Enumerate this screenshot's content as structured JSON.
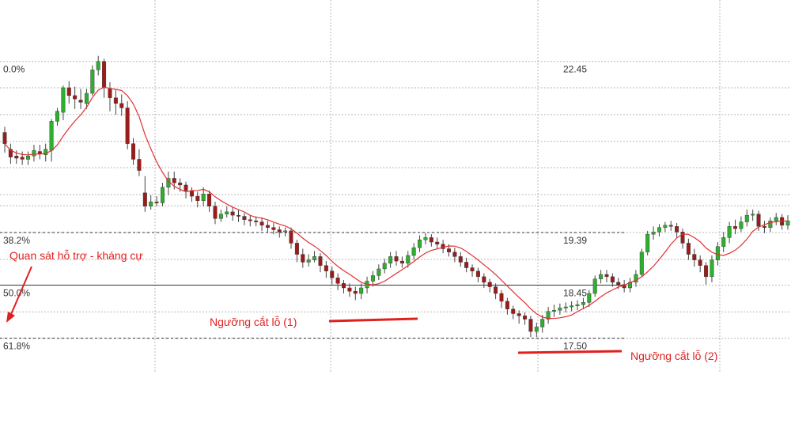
{
  "chart_data": {
    "type": "candlestick",
    "ylim": [
      16.9,
      23.55
    ],
    "grid": true,
    "colors": {
      "up": "#2fae2f",
      "down": "#9c1c1c",
      "ma_line": "#e03030",
      "grid": "#b8b8b8",
      "fib_line": "#333333",
      "annotation": "#e02020",
      "text": "#333333"
    },
    "fib_levels": [
      {
        "label": "0.0%",
        "price": 22.45,
        "price_label": "22.45"
      },
      {
        "label": "38.2%",
        "price": 19.39,
        "price_label": "19.39"
      },
      {
        "label": "50.0%",
        "price": 18.45,
        "price_label": "18.45"
      },
      {
        "label": "61.8%",
        "price": 17.5,
        "price_label": "17.50"
      }
    ],
    "annotations": [
      {
        "text": "Quan sát hỗ trợ - kháng cự"
      },
      {
        "text": "Ngưỡng cắt lỗ (1)"
      },
      {
        "text": "Ngưỡng cắt lỗ (2)"
      }
    ],
    "candles": [
      [
        21.18,
        20.98,
        21.28,
        20.82
      ],
      [
        20.88,
        20.74,
        20.98,
        20.62
      ],
      [
        20.76,
        20.72,
        20.86,
        20.62
      ],
      [
        20.74,
        20.7,
        20.84,
        20.6
      ],
      [
        20.7,
        20.76,
        20.84,
        20.6
      ],
      [
        20.76,
        20.86,
        20.96,
        20.66
      ],
      [
        20.84,
        20.8,
        20.96,
        20.7
      ],
      [
        20.78,
        20.88,
        20.98,
        20.66
      ],
      [
        20.86,
        21.38,
        21.42,
        20.66
      ],
      [
        21.38,
        21.56,
        21.62,
        21.3
      ],
      [
        21.54,
        21.98,
        22.02,
        21.4
      ],
      [
        21.98,
        21.84,
        22.1,
        21.7
      ],
      [
        21.84,
        21.78,
        22.0,
        21.6
      ],
      [
        21.76,
        21.72,
        21.96,
        21.6
      ],
      [
        21.7,
        21.88,
        21.96,
        21.6
      ],
      [
        21.88,
        22.3,
        22.38,
        21.84
      ],
      [
        22.3,
        22.45,
        22.55,
        22.2
      ],
      [
        22.45,
        21.98,
        22.5,
        21.8
      ],
      [
        21.96,
        21.8,
        22.08,
        21.56
      ],
      [
        21.8,
        21.7,
        21.94,
        21.5
      ],
      [
        21.7,
        21.62,
        21.86,
        21.48
      ],
      [
        21.62,
        20.98,
        21.74,
        20.88
      ],
      [
        20.98,
        20.7,
        21.08,
        20.6
      ],
      [
        20.7,
        20.5,
        20.88,
        20.4
      ],
      [
        20.1,
        19.86,
        20.4,
        19.76
      ],
      [
        19.86,
        19.94,
        20.06,
        19.8
      ],
      [
        19.94,
        19.92,
        20.04,
        19.86
      ],
      [
        19.92,
        20.2,
        20.28,
        19.86
      ],
      [
        20.2,
        20.36,
        20.48,
        20.06
      ],
      [
        20.36,
        20.28,
        20.48,
        20.16
      ],
      [
        20.28,
        20.24,
        20.36,
        20.12
      ],
      [
        20.24,
        20.14,
        20.3,
        20.0
      ],
      [
        20.14,
        20.04,
        20.2,
        19.94
      ],
      [
        20.04,
        19.96,
        20.12,
        19.84
      ],
      [
        19.96,
        20.08,
        20.2,
        19.86
      ],
      [
        20.08,
        19.86,
        20.14,
        19.76
      ],
      [
        19.86,
        19.64,
        19.94,
        19.54
      ],
      [
        19.64,
        19.72,
        19.8,
        19.58
      ],
      [
        19.72,
        19.76,
        19.86,
        19.66
      ],
      [
        19.76,
        19.7,
        19.84,
        19.6
      ],
      [
        19.7,
        19.68,
        19.8,
        19.58
      ],
      [
        19.68,
        19.62,
        19.74,
        19.52
      ],
      [
        19.62,
        19.6,
        19.7,
        19.5
      ],
      [
        19.6,
        19.58,
        19.68,
        19.5
      ],
      [
        19.58,
        19.52,
        19.66,
        19.42
      ],
      [
        19.52,
        19.48,
        19.6,
        19.38
      ],
      [
        19.48,
        19.44,
        19.56,
        19.36
      ],
      [
        19.44,
        19.4,
        19.5,
        19.3
      ],
      [
        19.4,
        19.42,
        19.48,
        19.32
      ],
      [
        19.42,
        19.2,
        19.48,
        19.1
      ],
      [
        19.2,
        19.0,
        19.26,
        18.86
      ],
      [
        19.0,
        18.86,
        19.1,
        18.76
      ],
      [
        18.86,
        18.9,
        19.0,
        18.78
      ],
      [
        18.9,
        18.96,
        19.06,
        18.86
      ],
      [
        18.96,
        18.8,
        19.02,
        18.68
      ],
      [
        18.8,
        18.7,
        18.88,
        18.58
      ],
      [
        18.7,
        18.58,
        18.78,
        18.46
      ],
      [
        18.58,
        18.48,
        18.66,
        18.36
      ],
      [
        18.48,
        18.4,
        18.54,
        18.3
      ],
      [
        18.4,
        18.34,
        18.48,
        18.24
      ],
      [
        18.34,
        18.3,
        18.42,
        18.18
      ],
      [
        18.3,
        18.4,
        18.48,
        18.2
      ],
      [
        18.4,
        18.52,
        18.6,
        18.3
      ],
      [
        18.52,
        18.62,
        18.7,
        18.42
      ],
      [
        18.62,
        18.74,
        18.82,
        18.54
      ],
      [
        18.74,
        18.84,
        18.92,
        18.66
      ],
      [
        18.84,
        18.96,
        19.04,
        18.76
      ],
      [
        18.96,
        18.88,
        19.06,
        18.8
      ],
      [
        18.88,
        18.84,
        18.96,
        18.76
      ],
      [
        18.84,
        18.98,
        19.06,
        18.76
      ],
      [
        18.98,
        19.12,
        19.2,
        18.9
      ],
      [
        19.12,
        19.26,
        19.34,
        19.04
      ],
      [
        19.26,
        19.3,
        19.38,
        19.18
      ],
      [
        19.3,
        19.22,
        19.36,
        19.14
      ],
      [
        19.22,
        19.18,
        19.3,
        19.1
      ],
      [
        19.18,
        19.1,
        19.26,
        19.02
      ],
      [
        19.1,
        19.04,
        19.18,
        18.96
      ],
      [
        19.04,
        18.96,
        19.12,
        18.86
      ],
      [
        18.96,
        18.86,
        19.04,
        18.78
      ],
      [
        18.86,
        18.76,
        18.94,
        18.68
      ],
      [
        18.76,
        18.7,
        18.82,
        18.6
      ],
      [
        18.7,
        18.6,
        18.76,
        18.5
      ],
      [
        18.6,
        18.5,
        18.66,
        18.4
      ],
      [
        18.5,
        18.42,
        18.56,
        18.32
      ],
      [
        18.42,
        18.3,
        18.48,
        18.2
      ],
      [
        18.3,
        18.16,
        18.36,
        18.04
      ],
      [
        18.16,
        18.02,
        18.22,
        17.92
      ],
      [
        18.02,
        17.94,
        18.08,
        17.84
      ],
      [
        17.94,
        17.9,
        18.0,
        17.76
      ],
      [
        17.9,
        17.84,
        17.96,
        17.74
      ],
      [
        17.84,
        17.62,
        17.9,
        17.52
      ],
      [
        17.62,
        17.7,
        17.78,
        17.52
      ],
      [
        17.7,
        17.84,
        17.92,
        17.6
      ],
      [
        17.84,
        17.98,
        18.06,
        17.76
      ],
      [
        17.98,
        18.0,
        18.1,
        17.88
      ],
      [
        18.0,
        18.04,
        18.12,
        17.92
      ],
      [
        18.04,
        18.06,
        18.14,
        17.96
      ],
      [
        18.06,
        18.08,
        18.16,
        17.98
      ],
      [
        18.08,
        18.1,
        18.18,
        18.0
      ],
      [
        18.1,
        18.14,
        18.22,
        18.02
      ],
      [
        18.14,
        18.3,
        18.36,
        18.06
      ],
      [
        18.3,
        18.56,
        18.62,
        18.24
      ],
      [
        18.56,
        18.64,
        18.72,
        18.48
      ],
      [
        18.64,
        18.6,
        18.72,
        18.5
      ],
      [
        18.6,
        18.5,
        18.66,
        18.42
      ],
      [
        18.5,
        18.46,
        18.58,
        18.38
      ],
      [
        18.46,
        18.4,
        18.54,
        18.32
      ],
      [
        18.4,
        18.5,
        18.58,
        18.32
      ],
      [
        18.5,
        18.64,
        18.72,
        18.42
      ],
      [
        18.64,
        19.04,
        19.1,
        18.6
      ],
      [
        19.04,
        19.36,
        19.42,
        18.98
      ],
      [
        19.36,
        19.4,
        19.5,
        19.26
      ],
      [
        19.4,
        19.48,
        19.54,
        19.32
      ],
      [
        19.48,
        19.52,
        19.58,
        19.4
      ],
      [
        19.52,
        19.5,
        19.6,
        19.42
      ],
      [
        19.5,
        19.4,
        19.56,
        19.3
      ],
      [
        19.4,
        19.2,
        19.46,
        19.1
      ],
      [
        19.2,
        19.0,
        19.28,
        18.9
      ],
      [
        19.0,
        18.9,
        19.1,
        18.78
      ],
      [
        18.9,
        18.8,
        18.98,
        18.68
      ],
      [
        18.8,
        18.6,
        18.86,
        18.46
      ],
      [
        18.6,
        18.9,
        18.98,
        18.5
      ],
      [
        18.9,
        19.14,
        19.22,
        18.8
      ],
      [
        19.14,
        19.3,
        19.4,
        19.04
      ],
      [
        19.3,
        19.5,
        19.58,
        19.2
      ],
      [
        19.5,
        19.46,
        19.62,
        19.36
      ],
      [
        19.46,
        19.58,
        19.68,
        19.4
      ],
      [
        19.58,
        19.7,
        19.8,
        19.5
      ],
      [
        19.7,
        19.72,
        19.8,
        19.6
      ],
      [
        19.72,
        19.5,
        19.78,
        19.42
      ],
      [
        19.5,
        19.48,
        19.6,
        19.38
      ],
      [
        19.48,
        19.6,
        19.66,
        19.4
      ],
      [
        19.6,
        19.66,
        19.74,
        19.52
      ],
      [
        19.66,
        19.52,
        19.72,
        19.44
      ],
      [
        19.52,
        19.6,
        19.7,
        19.44
      ]
    ]
  }
}
